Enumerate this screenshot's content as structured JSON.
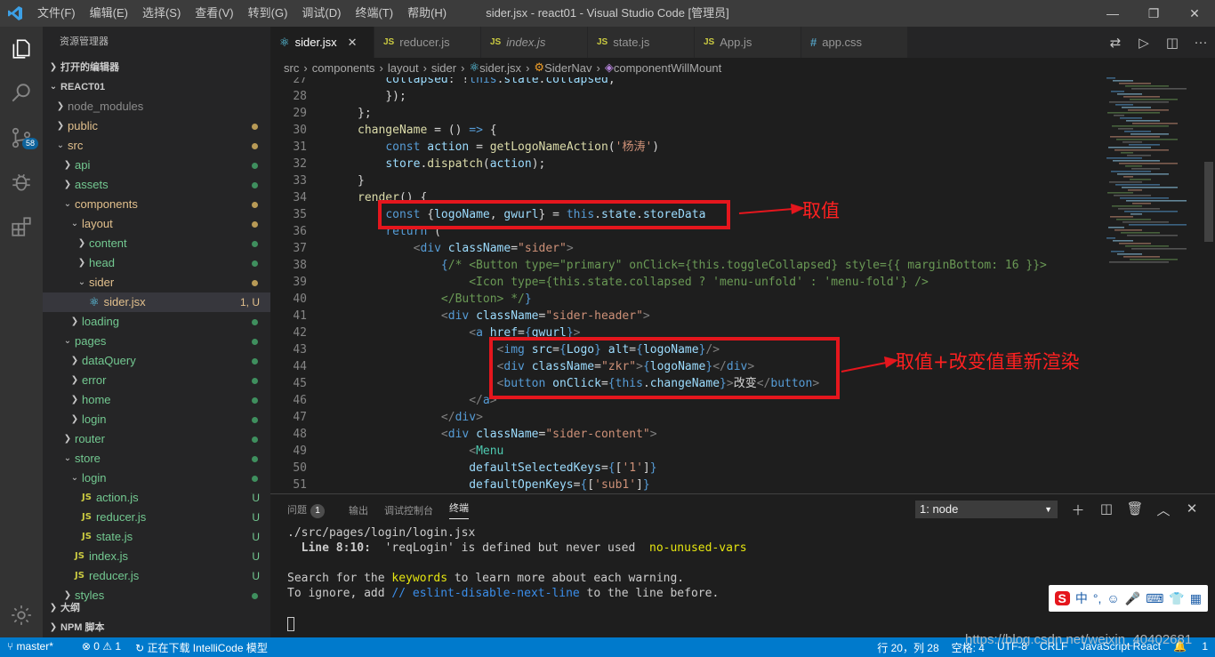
{
  "window": {
    "title": "sider.jsx - react01 - Visual Studio Code [管理员]",
    "menu": [
      "文件(F)",
      "编辑(E)",
      "选择(S)",
      "查看(V)",
      "转到(G)",
      "调试(D)",
      "终端(T)",
      "帮助(H)"
    ]
  },
  "activity": {
    "scm_badge": "58"
  },
  "sidebar": {
    "header": "资源管理器",
    "open_editors": "打开的编辑器",
    "project": "REACT01",
    "tree": [
      {
        "label": "node_modules",
        "depth": 0,
        "type": "folder",
        "open": false,
        "status": "ignored",
        "badge": ""
      },
      {
        "label": "public",
        "depth": 0,
        "type": "folder",
        "open": false,
        "status": "mod",
        "badge": "dot"
      },
      {
        "label": "src",
        "depth": 0,
        "type": "folder",
        "open": true,
        "status": "mod",
        "badge": "dot"
      },
      {
        "label": "api",
        "depth": 1,
        "type": "folder",
        "open": false,
        "status": "untr",
        "badge": "dot"
      },
      {
        "label": "assets",
        "depth": 1,
        "type": "folder",
        "open": false,
        "status": "untr",
        "badge": "dot"
      },
      {
        "label": "components",
        "depth": 1,
        "type": "folder",
        "open": true,
        "status": "mod",
        "badge": "dot"
      },
      {
        "label": "layout",
        "depth": 2,
        "type": "folder",
        "open": true,
        "status": "mod",
        "badge": "dot"
      },
      {
        "label": "content",
        "depth": 3,
        "type": "folder",
        "open": false,
        "status": "untr",
        "badge": "dot"
      },
      {
        "label": "head",
        "depth": 3,
        "type": "folder",
        "open": false,
        "status": "untr",
        "badge": "dot"
      },
      {
        "label": "sider",
        "depth": 3,
        "type": "folder",
        "open": true,
        "status": "mod",
        "badge": "dot"
      },
      {
        "label": "sider.jsx",
        "depth": 4,
        "type": "jsx",
        "open": false,
        "status": "mod",
        "badge": "1, U",
        "selected": true
      },
      {
        "label": "loading",
        "depth": 2,
        "type": "folder",
        "open": false,
        "status": "untr",
        "badge": "dot"
      },
      {
        "label": "pages",
        "depth": 1,
        "type": "folder",
        "open": true,
        "status": "untr",
        "badge": "dot"
      },
      {
        "label": "dataQuery",
        "depth": 2,
        "type": "folder",
        "open": false,
        "status": "untr",
        "badge": "dot"
      },
      {
        "label": "error",
        "depth": 2,
        "type": "folder",
        "open": false,
        "status": "untr",
        "badge": "dot"
      },
      {
        "label": "home",
        "depth": 2,
        "type": "folder",
        "open": false,
        "status": "untr",
        "badge": "dot"
      },
      {
        "label": "login",
        "depth": 2,
        "type": "folder",
        "open": false,
        "status": "untr",
        "badge": "dot"
      },
      {
        "label": "router",
        "depth": 1,
        "type": "folder",
        "open": false,
        "status": "untr",
        "badge": "dot"
      },
      {
        "label": "store",
        "depth": 1,
        "type": "folder",
        "open": true,
        "status": "untr",
        "badge": "dot"
      },
      {
        "label": "login",
        "depth": 2,
        "type": "folder",
        "open": true,
        "status": "untr",
        "badge": "dot"
      },
      {
        "label": "action.js",
        "depth": 3,
        "type": "js",
        "open": false,
        "status": "untr",
        "badge": "U"
      },
      {
        "label": "reducer.js",
        "depth": 3,
        "type": "js",
        "open": false,
        "status": "untr",
        "badge": "U"
      },
      {
        "label": "state.js",
        "depth": 3,
        "type": "js",
        "open": false,
        "status": "untr",
        "badge": "U"
      },
      {
        "label": "index.js",
        "depth": 2,
        "type": "js",
        "open": false,
        "status": "untr",
        "badge": "U"
      },
      {
        "label": "reducer.js",
        "depth": 2,
        "type": "js",
        "open": false,
        "status": "untr",
        "badge": "U"
      },
      {
        "label": "styles",
        "depth": 1,
        "type": "folder",
        "open": false,
        "status": "untr",
        "badge": "dot"
      }
    ],
    "outline": "大纲",
    "npm": "NPM 脚本"
  },
  "tabs": [
    {
      "label": "sider.jsx",
      "icon": "react",
      "active": true
    },
    {
      "label": "reducer.js",
      "icon": "JS",
      "active": false
    },
    {
      "label": "index.js",
      "icon": "JS",
      "active": false
    },
    {
      "label": "state.js",
      "icon": "JS",
      "active": false
    },
    {
      "label": "App.js",
      "icon": "JS",
      "active": false
    },
    {
      "label": "app.css",
      "icon": "#",
      "active": false
    }
  ],
  "breadcrumb": [
    "src",
    "components",
    "layout",
    "sider",
    "sider.jsx",
    "SiderNav",
    "componentWillMount"
  ],
  "code_lines": [
    {
      "n": "27",
      "indent": 2,
      "tokens": [
        [
          "v",
          "collapsed"
        ],
        [
          "o",
          ": !"
        ],
        [
          "k",
          "this"
        ],
        [
          "o",
          "."
        ],
        [
          "v",
          "state"
        ],
        [
          "o",
          "."
        ],
        [
          "v",
          "collapsed"
        ],
        [
          "o",
          ","
        ]
      ]
    },
    {
      "n": "28",
      "indent": 2,
      "tokens": [
        [
          "o",
          "});"
        ]
      ]
    },
    {
      "n": "29",
      "indent": 1,
      "tokens": [
        [
          "o",
          "};"
        ]
      ]
    },
    {
      "n": "30",
      "indent": 1,
      "tokens": [
        [
          "f",
          "changeName"
        ],
        [
          "o",
          " = () "
        ],
        [
          "k",
          "=>"
        ],
        [
          "o",
          " {"
        ]
      ]
    },
    {
      "n": "31",
      "indent": 2,
      "tokens": [
        [
          "k",
          "const"
        ],
        [
          "o",
          " "
        ],
        [
          "v",
          "action"
        ],
        [
          "o",
          " = "
        ],
        [
          "f",
          "getLogoNameAction"
        ],
        [
          "o",
          "("
        ],
        [
          "s",
          "'杨涛'"
        ],
        [
          "o",
          ")"
        ]
      ]
    },
    {
      "n": "32",
      "indent": 2,
      "tokens": [
        [
          "v",
          "store"
        ],
        [
          "o",
          "."
        ],
        [
          "f",
          "dispatch"
        ],
        [
          "o",
          "("
        ],
        [
          "v",
          "action"
        ],
        [
          "o",
          ");"
        ]
      ]
    },
    {
      "n": "33",
      "indent": 1,
      "tokens": [
        [
          "o",
          "}"
        ]
      ]
    },
    {
      "n": "34",
      "indent": 1,
      "tokens": [
        [
          "f",
          "render"
        ],
        [
          "o",
          "() {"
        ]
      ]
    },
    {
      "n": "35",
      "indent": 2,
      "tokens": [
        [
          "k",
          "const"
        ],
        [
          "o",
          " {"
        ],
        [
          "v",
          "logoName"
        ],
        [
          "o",
          ", "
        ],
        [
          "v",
          "gwurl"
        ],
        [
          "o",
          "} = "
        ],
        [
          "k",
          "this"
        ],
        [
          "o",
          "."
        ],
        [
          "v",
          "state"
        ],
        [
          "o",
          "."
        ],
        [
          "v",
          "storeData"
        ]
      ]
    },
    {
      "n": "36",
      "indent": 2,
      "tokens": [
        [
          "k",
          "return"
        ],
        [
          "o",
          " ("
        ]
      ]
    },
    {
      "n": "37",
      "indent": 3,
      "tokens": [
        [
          "p",
          "<"
        ],
        [
          "k",
          "div"
        ],
        [
          "o",
          " "
        ],
        [
          "v",
          "className"
        ],
        [
          "o",
          "="
        ],
        [
          "s",
          "\"sider\""
        ],
        [
          "p",
          ">"
        ]
      ]
    },
    {
      "n": "38",
      "indent": 4,
      "tokens": [
        [
          "k",
          "{"
        ],
        [
          "cm",
          "/* <Button type=\"primary\" onClick={this.toggleCollapsed} style={{ marginBottom: 16 }}>"
        ]
      ]
    },
    {
      "n": "39",
      "indent": 5,
      "tokens": [
        [
          "cm",
          "<Icon type={this.state.collapsed ? 'menu-unfold' : 'menu-fold'} />"
        ]
      ]
    },
    {
      "n": "40",
      "indent": 4,
      "tokens": [
        [
          "cm",
          "</Button> */"
        ],
        [
          "k",
          "}"
        ]
      ]
    },
    {
      "n": "41",
      "indent": 4,
      "tokens": [
        [
          "p",
          "<"
        ],
        [
          "k",
          "div"
        ],
        [
          "o",
          " "
        ],
        [
          "v",
          "className"
        ],
        [
          "o",
          "="
        ],
        [
          "s",
          "\"sider-header\""
        ],
        [
          "p",
          ">"
        ]
      ]
    },
    {
      "n": "42",
      "indent": 5,
      "tokens": [
        [
          "p",
          "<"
        ],
        [
          "k",
          "a"
        ],
        [
          "o",
          " "
        ],
        [
          "v",
          "href"
        ],
        [
          "o",
          "="
        ],
        [
          "k",
          "{"
        ],
        [
          "v",
          "gwurl"
        ],
        [
          "k",
          "}"
        ],
        [
          "p",
          ">"
        ]
      ]
    },
    {
      "n": "43",
      "indent": 6,
      "tokens": [
        [
          "p",
          "<"
        ],
        [
          "k",
          "img"
        ],
        [
          "o",
          " "
        ],
        [
          "v",
          "src"
        ],
        [
          "o",
          "="
        ],
        [
          "k",
          "{"
        ],
        [
          "v",
          "Logo"
        ],
        [
          "k",
          "}"
        ],
        [
          "o",
          " "
        ],
        [
          "v",
          "alt"
        ],
        [
          "o",
          "="
        ],
        [
          "k",
          "{"
        ],
        [
          "v",
          "logoName"
        ],
        [
          "k",
          "}"
        ],
        [
          "p",
          "/>"
        ]
      ]
    },
    {
      "n": "44",
      "indent": 6,
      "tokens": [
        [
          "p",
          "<"
        ],
        [
          "k",
          "div"
        ],
        [
          "o",
          " "
        ],
        [
          "v",
          "className"
        ],
        [
          "o",
          "="
        ],
        [
          "s",
          "\"zkr\""
        ],
        [
          "p",
          ">"
        ],
        [
          "k",
          "{"
        ],
        [
          "v",
          "logoName"
        ],
        [
          "k",
          "}"
        ],
        [
          "p",
          "</"
        ],
        [
          "k",
          "div"
        ],
        [
          "p",
          ">"
        ]
      ]
    },
    {
      "n": "45",
      "indent": 6,
      "tokens": [
        [
          "p",
          "<"
        ],
        [
          "k",
          "button"
        ],
        [
          "o",
          " "
        ],
        [
          "v",
          "onClick"
        ],
        [
          "o",
          "="
        ],
        [
          "k",
          "{"
        ],
        [
          "k",
          "this"
        ],
        [
          "o",
          "."
        ],
        [
          "v",
          "changeName"
        ],
        [
          "k",
          "}"
        ],
        [
          "p",
          ">"
        ],
        [
          "w",
          "改变"
        ],
        [
          "p",
          "</"
        ],
        [
          "k",
          "button"
        ],
        [
          "p",
          ">"
        ]
      ]
    },
    {
      "n": "46",
      "indent": 5,
      "tokens": [
        [
          "p",
          "</"
        ],
        [
          "k",
          "a"
        ],
        [
          "p",
          ">"
        ]
      ]
    },
    {
      "n": "47",
      "indent": 4,
      "tokens": [
        [
          "p",
          "</"
        ],
        [
          "k",
          "div"
        ],
        [
          "p",
          ">"
        ]
      ]
    },
    {
      "n": "48",
      "indent": 4,
      "tokens": [
        [
          "p",
          "<"
        ],
        [
          "k",
          "div"
        ],
        [
          "o",
          " "
        ],
        [
          "v",
          "className"
        ],
        [
          "o",
          "="
        ],
        [
          "s",
          "\"sider-content\""
        ],
        [
          "p",
          ">"
        ]
      ]
    },
    {
      "n": "49",
      "indent": 5,
      "tokens": [
        [
          "p",
          "<"
        ],
        [
          "t",
          "Menu"
        ]
      ]
    },
    {
      "n": "50",
      "indent": 5,
      "tokens": [
        [
          "v",
          "defaultSelectedKeys"
        ],
        [
          "o",
          "="
        ],
        [
          "k",
          "{"
        ],
        [
          "o",
          "["
        ],
        [
          "s",
          "'1'"
        ],
        [
          "o",
          "]"
        ],
        [
          "k",
          "}"
        ]
      ]
    },
    {
      "n": "51",
      "indent": 5,
      "tokens": [
        [
          "v",
          "defaultOpenKeys"
        ],
        [
          "o",
          "="
        ],
        [
          "k",
          "{"
        ],
        [
          "o",
          "["
        ],
        [
          "s",
          "'sub1'"
        ],
        [
          "o",
          "]"
        ],
        [
          "k",
          "}"
        ]
      ]
    }
  ],
  "annotations": {
    "first": "取值",
    "second": "取值+改变值重新渲染",
    "color": "#e5161d"
  },
  "panel": {
    "tabs": [
      {
        "label": "问题",
        "count": "1"
      },
      {
        "label": "输出"
      },
      {
        "label": "调试控制台"
      },
      {
        "label": "终端",
        "active": true
      }
    ],
    "terminal_select": "1: node",
    "terminal": {
      "path": "./src/pages/login/login.jsx",
      "warn_pre": "  Line 8:10:  ",
      "warn_msg": "'reqLogin' is defined but never used  ",
      "warn_rule": "no-unused-vars",
      "help1_pre": "Search for the ",
      "help1_kw": "keywords",
      "help1_post": " to learn more about each warning.",
      "help2_pre": "To ignore, add ",
      "help2_kw": "// eslint-disable-next-line",
      "help2_post": " to the line before."
    },
    "ime": [
      "中",
      "°,",
      "☺",
      "🎤",
      "⌨",
      "👕",
      "▦"
    ]
  },
  "status": {
    "branch": "master*",
    "problems": "⊗ 0 ⚠ 1",
    "intellicode": "正在下载 IntelliCode 模型",
    "position": "行 20，列 28",
    "spaces": "空格: 4",
    "encoding": "UTF-8",
    "eol": "CRLF",
    "language": "JavaScript React",
    "notifications": "1"
  },
  "watermark": "https://blog.csdn.net/weixin_40402681"
}
